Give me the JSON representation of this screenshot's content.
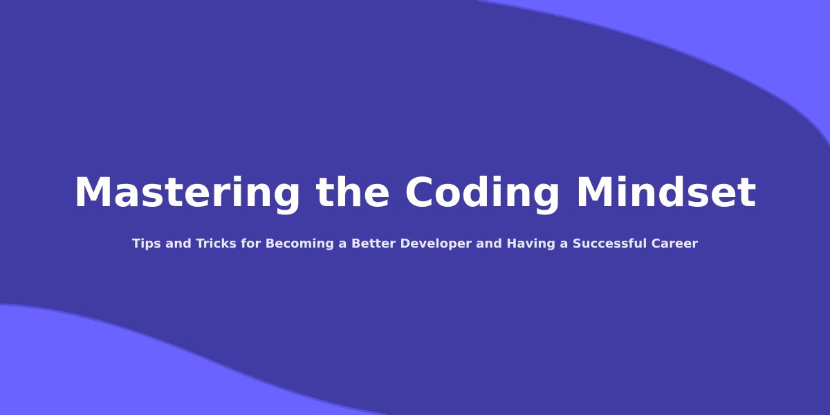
{
  "colors": {
    "background": "#403ca3",
    "accent_wave": "#6a63ff",
    "wave_edge": "#5550d8",
    "text": "#ffffff"
  },
  "banner": {
    "title": "Mastering the Coding Mindset",
    "subtitle": "Tips and Tricks for Becoming a Better Developer and Having a Successful Career"
  }
}
